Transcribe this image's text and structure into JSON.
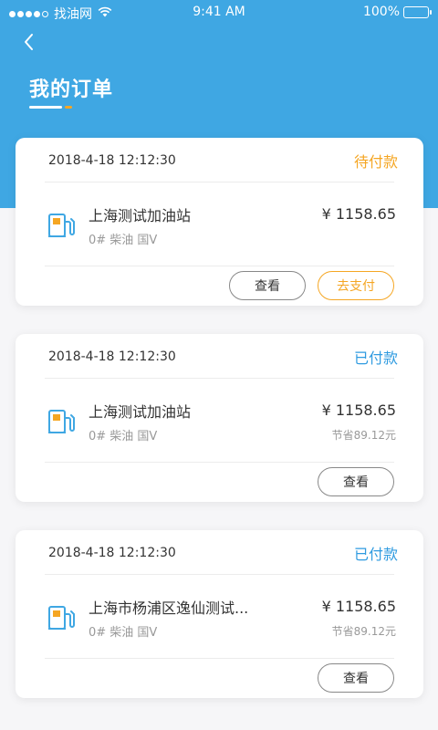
{
  "status_bar": {
    "carrier": "找油网",
    "time": "9:41 AM",
    "battery": "100%"
  },
  "header": {
    "title": "我的订单"
  },
  "colors": {
    "primary": "#3fa7e3",
    "pending": "#f5a623",
    "paid": "#2f9be0"
  },
  "orders": [
    {
      "time": "2018-4-18 12:12:30",
      "status": "待付款",
      "station": "上海测试加油站",
      "fuel": "0#  柴油  国V",
      "price": "¥ 1158.65",
      "saving": "",
      "view_label": "查看",
      "pay_label": "去支付"
    },
    {
      "time": "2018-4-18 12:12:30",
      "status": "已付款",
      "station": "上海测试加油站",
      "fuel": "0#  柴油  国V",
      "price": "¥ 1158.65",
      "saving": "节省89.12元",
      "view_label": "查看"
    },
    {
      "time": "2018-4-18 12:12:30",
      "status": "已付款",
      "station": "上海市杨浦区逸仙测试...",
      "fuel": "0#  柴油  国V",
      "price": "¥ 1158.65",
      "saving": "节省89.12元",
      "view_label": "查看"
    }
  ]
}
